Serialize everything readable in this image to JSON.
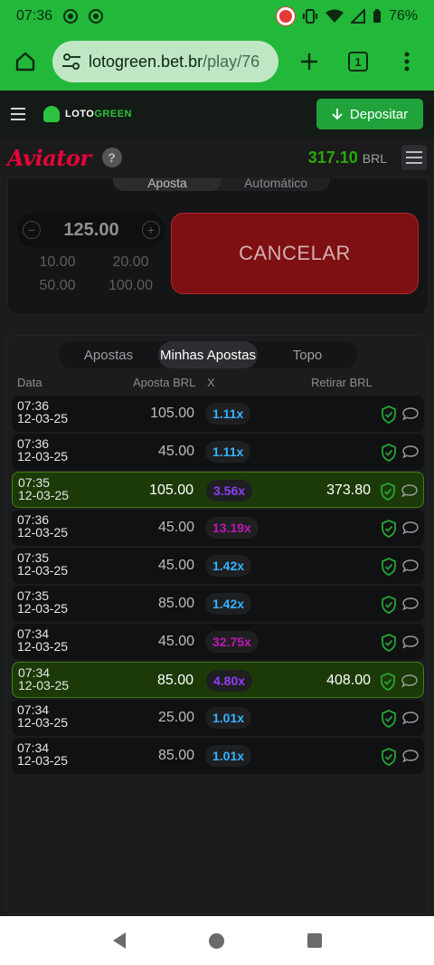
{
  "status_bar": {
    "time": "07:36",
    "battery": "76%"
  },
  "browser": {
    "url_host": "lotogreen.bet.br",
    "url_path": "/play/76",
    "tab_count": "1"
  },
  "site_header": {
    "logo_a": "LOTO",
    "logo_b": "GREEN",
    "deposit_label": "Depositar"
  },
  "game_bar": {
    "logo": "Aviator",
    "help": "?",
    "balance": "317.10",
    "currency": "BRL"
  },
  "bet_panel": {
    "tabs": [
      "Aposta",
      "Automático"
    ],
    "stake": "125.00",
    "minus": "−",
    "plus": "+",
    "quick_amounts": [
      "10.00",
      "20.00",
      "50.00",
      "100.00"
    ],
    "cancel_label": "CANCELAR"
  },
  "history": {
    "tabs": [
      "Apostas",
      "Minhas Apostas",
      "Topo"
    ],
    "active_tab": 1,
    "columns": {
      "date": "Data",
      "bet": "Aposta BRL",
      "mult": "X",
      "cashout": "Retirar BRL"
    },
    "rows": [
      {
        "time": "07:36",
        "date": "12-03-25",
        "bet": "105.00",
        "mult": "1.11x",
        "cashout": "",
        "win": false,
        "color": "#34b4ff"
      },
      {
        "time": "07:36",
        "date": "12-03-25",
        "bet": "45.00",
        "mult": "1.11x",
        "cashout": "",
        "win": false,
        "color": "#34b4ff"
      },
      {
        "time": "07:35",
        "date": "12-03-25",
        "bet": "105.00",
        "mult": "3.56x",
        "cashout": "373.80",
        "win": true,
        "color": "#913ef8"
      },
      {
        "time": "07:36",
        "date": "12-03-25",
        "bet": "45.00",
        "mult": "13.19x",
        "cashout": "",
        "win": false,
        "color": "#c017b4"
      },
      {
        "time": "07:35",
        "date": "12-03-25",
        "bet": "45.00",
        "mult": "1.42x",
        "cashout": "",
        "win": false,
        "color": "#34b4ff"
      },
      {
        "time": "07:35",
        "date": "12-03-25",
        "bet": "85.00",
        "mult": "1.42x",
        "cashout": "",
        "win": false,
        "color": "#34b4ff"
      },
      {
        "time": "07:34",
        "date": "12-03-25",
        "bet": "45.00",
        "mult": "32.75x",
        "cashout": "",
        "win": false,
        "color": "#c017b4"
      },
      {
        "time": "07:34",
        "date": "12-03-25",
        "bet": "85.00",
        "mult": "4.80x",
        "cashout": "408.00",
        "win": true,
        "color": "#913ef8"
      },
      {
        "time": "07:34",
        "date": "12-03-25",
        "bet": "25.00",
        "mult": "1.01x",
        "cashout": "",
        "win": false,
        "color": "#34b4ff"
      },
      {
        "time": "07:34",
        "date": "12-03-25",
        "bet": "85.00",
        "mult": "1.01x",
        "cashout": "",
        "win": false,
        "color": "#34b4ff"
      }
    ]
  },
  "icons": {
    "home": "home-icon",
    "site_settings": "tune-icon",
    "new_tab": "plus-icon",
    "more": "more-vert-icon",
    "provably_fair": "shield-check-icon",
    "chat": "chat-bubble-icon"
  }
}
